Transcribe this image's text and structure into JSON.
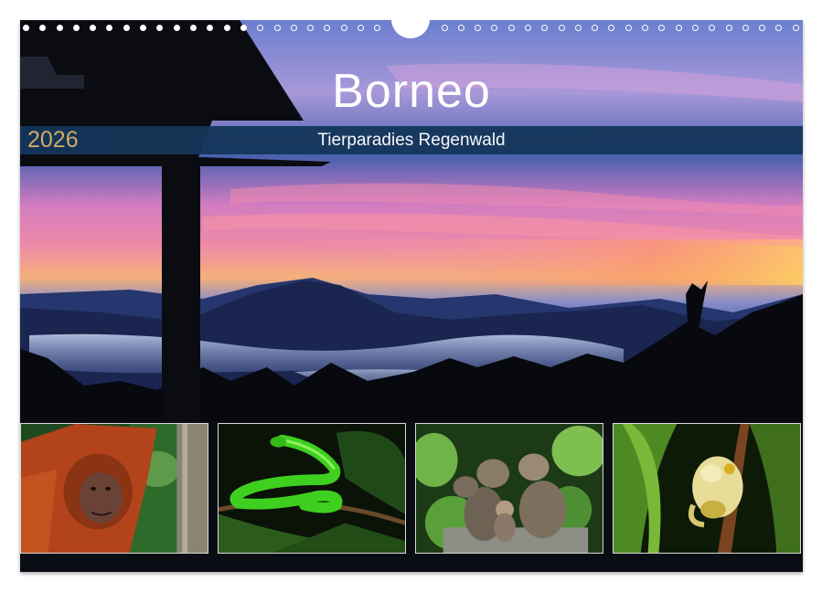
{
  "calendar": {
    "title": "Borneo",
    "year": "2026",
    "subtitle": "Tierparadies Regenwald"
  },
  "photos": [
    {
      "subject": "orangutan"
    },
    {
      "subject": "green pit viper"
    },
    {
      "subject": "long-tailed macaques"
    },
    {
      "subject": "tree frog"
    }
  ],
  "colors": {
    "band": "#14365a",
    "year": "#d8b36c",
    "title": "#ffffff"
  }
}
